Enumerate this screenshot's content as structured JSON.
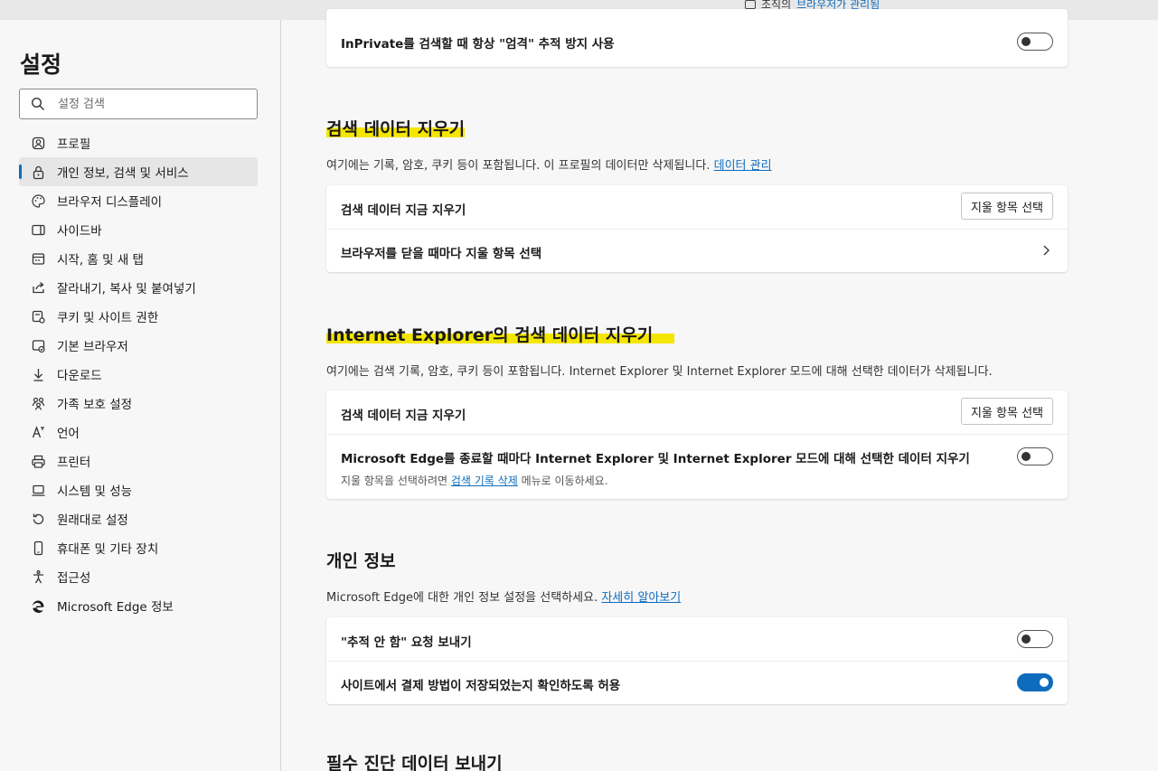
{
  "topbar": {
    "managed_prefix": "조직의",
    "managed_link": "브라우저가 관리됨"
  },
  "sidebar": {
    "title": "설정",
    "search_placeholder": "설정 검색",
    "items": [
      {
        "label": "프로필",
        "icon": "profile-icon"
      },
      {
        "label": "개인 정보, 검색 및 서비스",
        "icon": "lock-icon",
        "active": true
      },
      {
        "label": "브라우저 디스플레이",
        "icon": "palette-icon"
      },
      {
        "label": "사이드바",
        "icon": "sidebar-icon"
      },
      {
        "label": "시작, 홈 및 새 탭",
        "icon": "home-tabs-icon"
      },
      {
        "label": "잘라내기, 복사 및 붙여넣기",
        "icon": "share-icon"
      },
      {
        "label": "쿠키 및 사이트 권한",
        "icon": "site-permissions-icon"
      },
      {
        "label": "기본 브라우저",
        "icon": "default-browser-icon"
      },
      {
        "label": "다운로드",
        "icon": "download-icon"
      },
      {
        "label": "가족 보호 설정",
        "icon": "family-icon"
      },
      {
        "label": "언어",
        "icon": "language-icon"
      },
      {
        "label": "프린터",
        "icon": "printer-icon"
      },
      {
        "label": "시스템 및 성능",
        "icon": "system-icon"
      },
      {
        "label": "원래대로 설정",
        "icon": "reset-icon"
      },
      {
        "label": "휴대폰 및 기타 장치",
        "icon": "phone-icon"
      },
      {
        "label": "접근성",
        "icon": "accessibility-icon"
      },
      {
        "label": "Microsoft Edge 정보",
        "icon": "edge-icon"
      }
    ]
  },
  "main": {
    "inprivate": {
      "label": "InPrivate를 검색할 때 항상 \"엄격\" 추적 방지 사용",
      "toggle_on": false
    },
    "clear_data": {
      "title": "검색 데이터 지우기",
      "desc": "여기에는 기록, 암호, 쿠키 등이 포함됩니다. 이 프로필의 데이터만 삭제됩니다.",
      "desc_link": "데이터 관리",
      "row1_label": "검색 데이터 지금 지우기",
      "row1_button": "지울 항목 선택",
      "row2_label": "브라우저를 닫을 때마다 지울 항목 선택"
    },
    "ie_clear": {
      "title": "Internet Explorer의 검색 데이터 지우기",
      "desc": "여기에는 검색 기록, 암호, 쿠키 등이 포함됩니다. Internet Explorer 및 Internet Explorer 모드에 대해 선택한 데이터가 삭제됩니다.",
      "row1_label": "검색 데이터 지금 지우기",
      "row1_button": "지울 항목 선택",
      "row2_label": "Microsoft Edge를 종료할 때마다 Internet Explorer 및 Internet Explorer 모드에 대해 선택한 데이터 지우기",
      "row2_sub_prefix": "지울 항목을 선택하려면",
      "row2_sub_link": "검색 기록 삭제",
      "row2_sub_suffix": "메뉴로 이동하세요.",
      "row2_toggle_on": false
    },
    "privacy": {
      "title": "개인 정보",
      "desc": "Microsoft Edge에 대한 개인 정보 설정을 선택하세요.",
      "desc_link": "자세히 알아보기",
      "row1_label": "\"추적 안 함\" 요청 보내기",
      "row1_toggle_on": false,
      "row2_label": "사이트에서 결제 방법이 저장되었는지 확인하도록 허용",
      "row2_toggle_on": true
    },
    "diagnostics": {
      "title": "필수 진단 데이터 보내기"
    }
  },
  "colors": {
    "accent": "#0f6cbd",
    "highlight": "#f5e600"
  }
}
